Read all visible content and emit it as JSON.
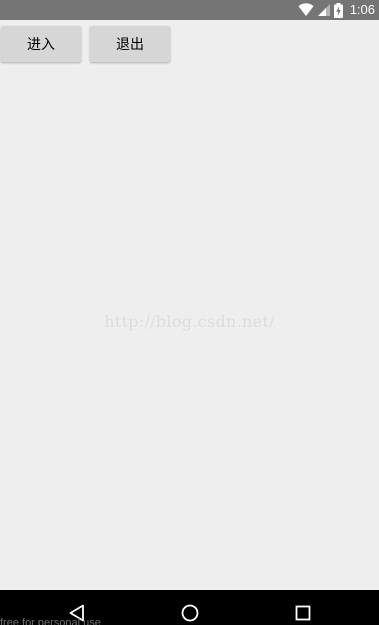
{
  "status_bar": {
    "time": "1:06",
    "icons": [
      "wifi-icon",
      "signal-icon",
      "battery-charging-icon"
    ]
  },
  "actions": {
    "enter_label": "进入",
    "exit_label": "退出"
  },
  "watermark": "http://blog.csdn.net/",
  "navigation_bar": {
    "icons": [
      "back-icon",
      "home-icon",
      "recents-icon"
    ],
    "overlay_text": "free for personal use"
  }
}
